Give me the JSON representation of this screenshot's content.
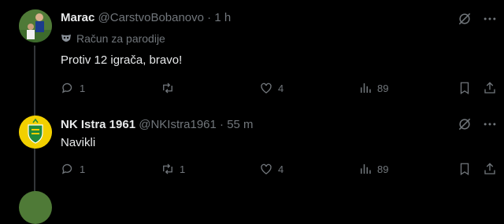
{
  "tweets": [
    {
      "author_name": "Marac",
      "handle": "@CarstvoBobanovo",
      "separator": "·",
      "time": "1 h",
      "parody_label": "Račun za parodije",
      "text": "Protiv 12 igrača, bravo!",
      "replies": "1",
      "reposts": "",
      "likes": "4",
      "views": "89"
    },
    {
      "author_name": "NK Istra 1961",
      "handle": "@NKIstra1961",
      "separator": "·",
      "time": "55 m",
      "text": "Navikli",
      "replies": "1",
      "reposts": "1",
      "likes": "4",
      "views": "89"
    }
  ],
  "colors": {
    "background": "#000000",
    "text": "#e7e9ea",
    "muted": "#71767b",
    "istra_yellow": "#f2d000",
    "istra_green": "#1f8a3a"
  }
}
